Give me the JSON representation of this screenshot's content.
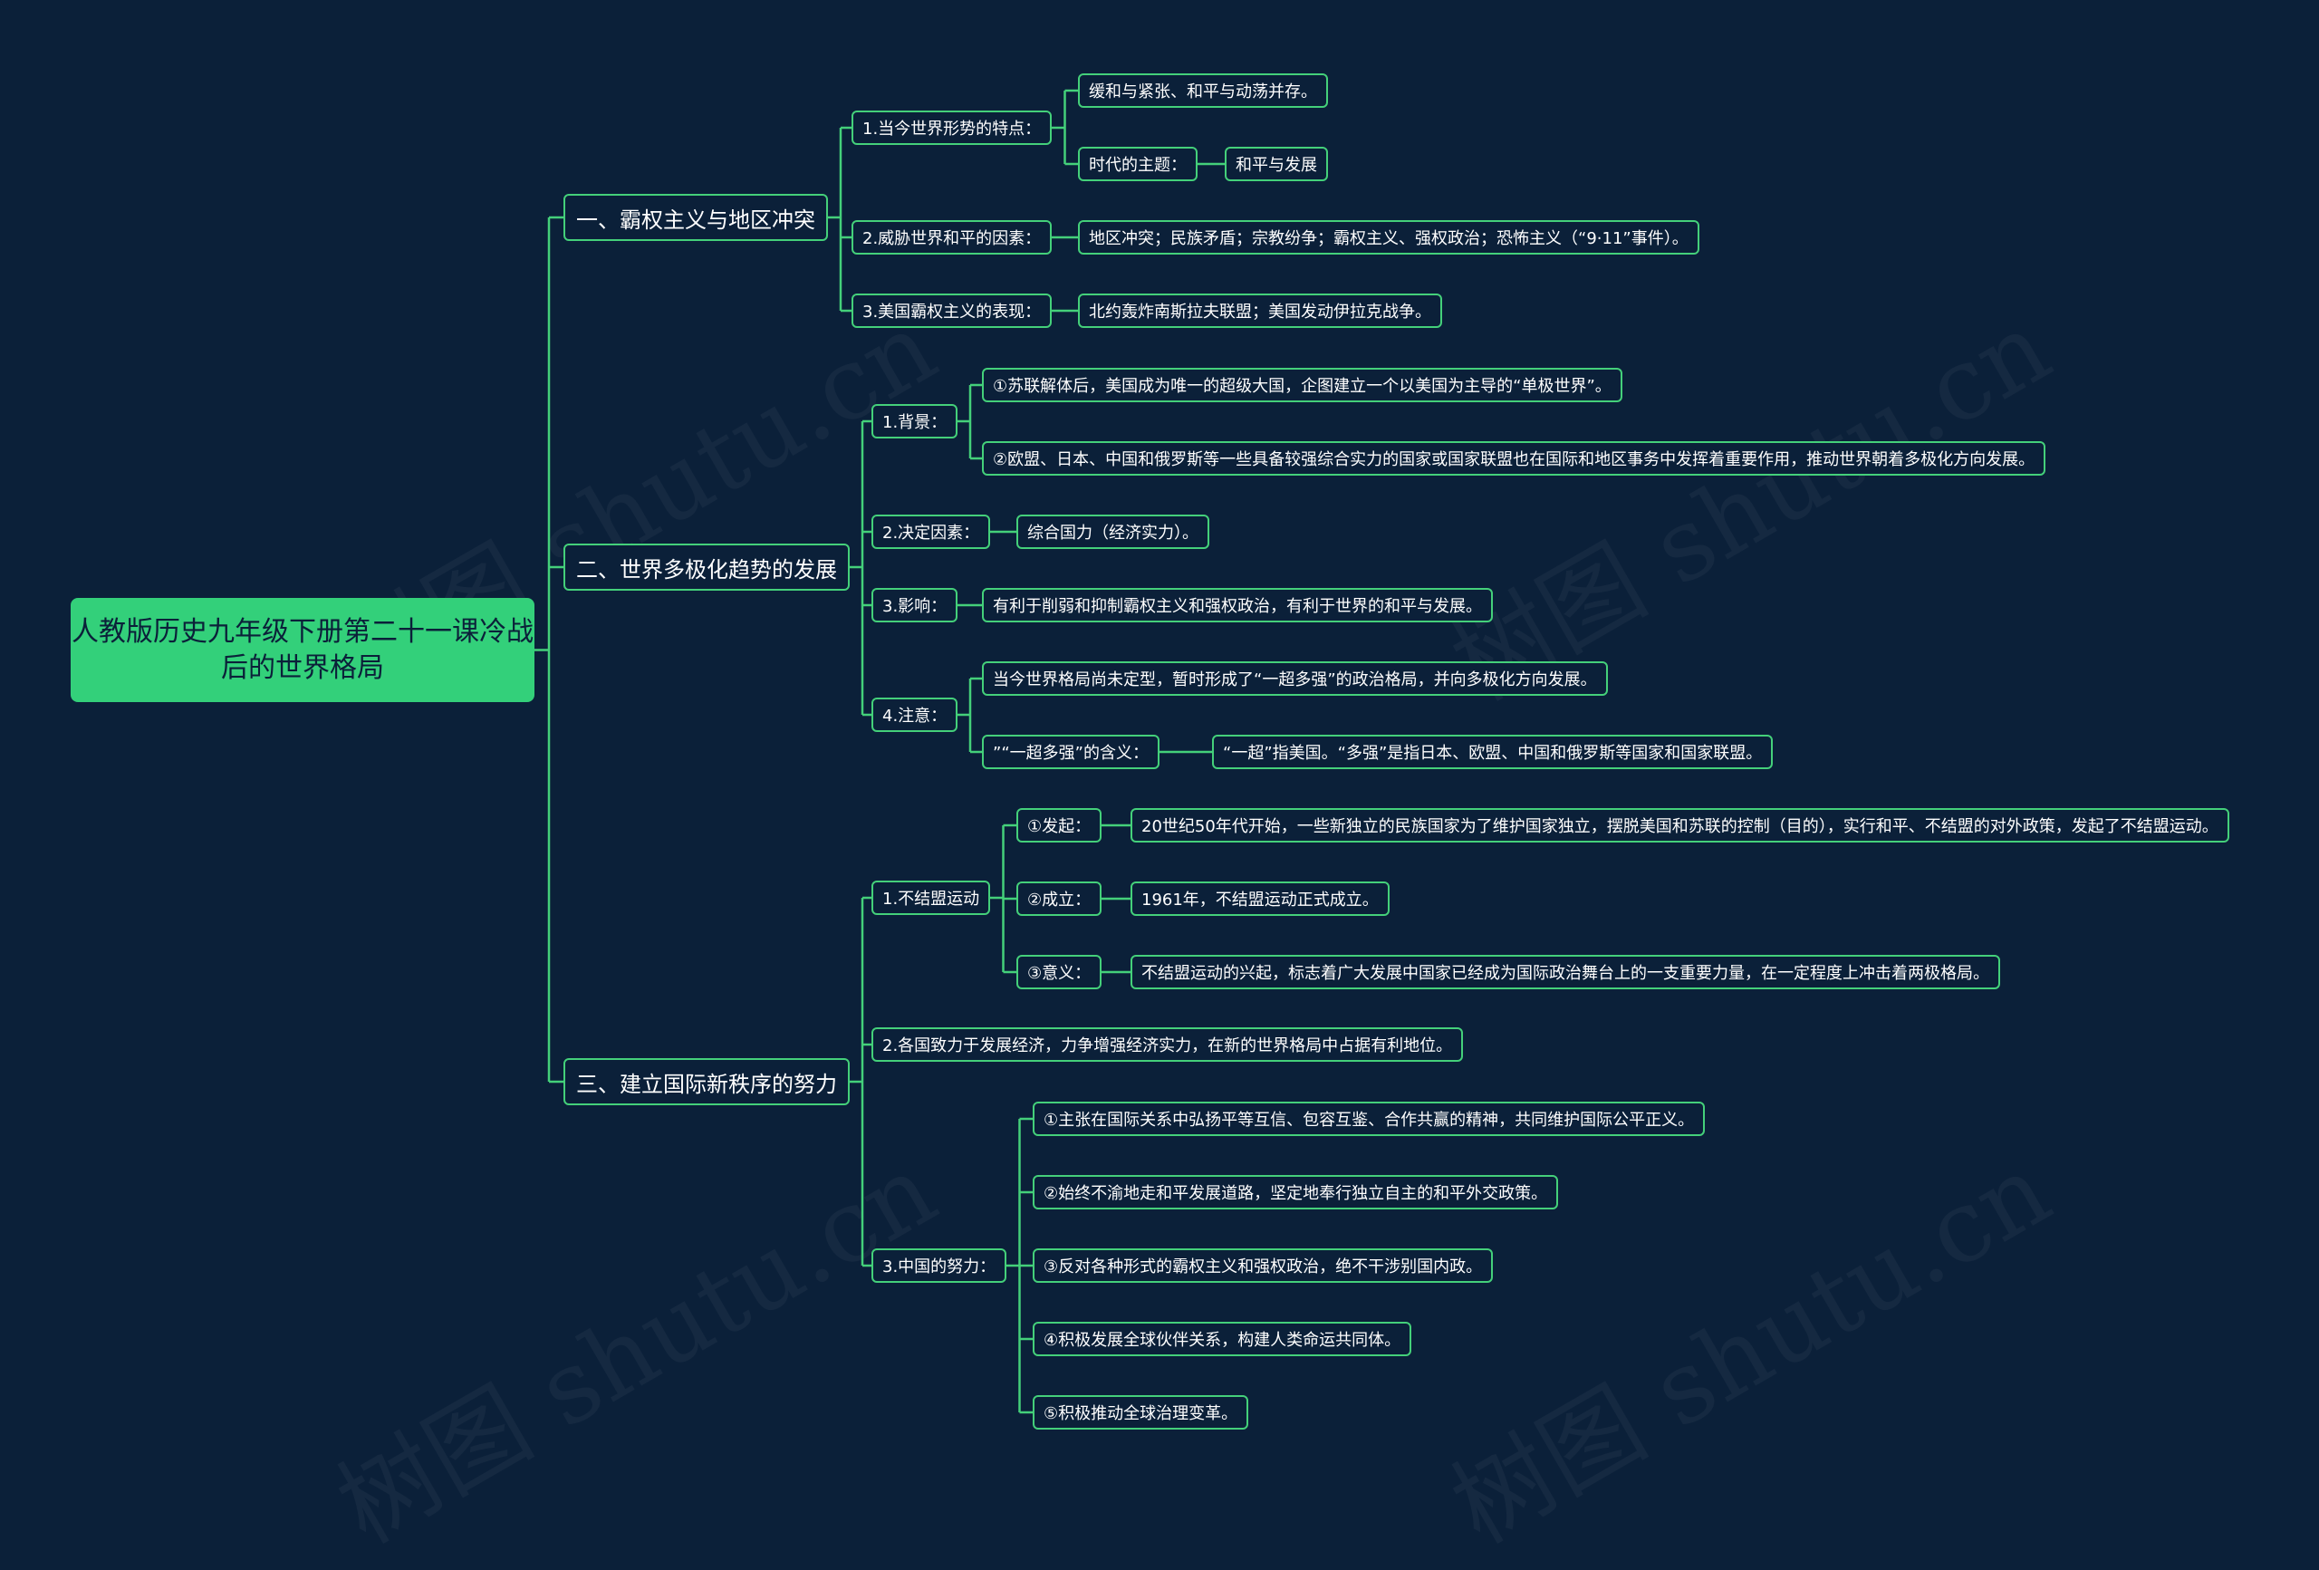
{
  "watermark": "树图 shutu.cn",
  "colors": {
    "background": "#0b2039",
    "accent": "#44d07a",
    "root_fill": "#33d07a",
    "text": "#ffffff"
  },
  "mindmap": {
    "root": "人教版历史九年级下册第二十一课冷战后的世界格局",
    "branches": [
      {
        "label": "一、霸权主义与地区冲突",
        "children": [
          {
            "label": "1.当今世界形势的特点：",
            "children": [
              {
                "label": "缓和与紧张、和平与动荡并存。"
              },
              {
                "label": "时代的主题：",
                "children": [
                  {
                    "label": "和平与发展"
                  }
                ]
              }
            ]
          },
          {
            "label": "2.威胁世界和平的因素：",
            "children": [
              {
                "label": "地区冲突；民族矛盾；宗教纷争；霸权主义、强权政治；恐怖主义（“9·11”事件）。"
              }
            ]
          },
          {
            "label": "3.美国霸权主义的表现：",
            "children": [
              {
                "label": "北约轰炸南斯拉夫联盟；美国发动伊拉克战争。"
              }
            ]
          }
        ]
      },
      {
        "label": "二、世界多极化趋势的发展",
        "children": [
          {
            "label": "1.背景：",
            "children": [
              {
                "label": "①苏联解体后，美国成为唯一的超级大国，企图建立一个以美国为主导的“单极世界”。"
              },
              {
                "label": "②欧盟、日本、中国和俄罗斯等一些具备较强综合实力的国家或国家联盟也在国际和地区事务中发挥着重要作用，推动世界朝着多极化方向发展。"
              }
            ]
          },
          {
            "label": "2.决定因素：",
            "children": [
              {
                "label": "综合国力（经济实力）。"
              }
            ]
          },
          {
            "label": "3.影响：",
            "children": [
              {
                "label": "有利于削弱和抑制霸权主义和强权政治，有利于世界的和平与发展。"
              }
            ]
          },
          {
            "label": "4.注意：",
            "children": [
              {
                "label": "当今世界格局尚未定型，暂时形成了“一超多强”的政治格局，并向多极化方向发展。"
              },
              {
                "label": "”“一超多强”的含义：",
                "children": [
                  {
                    "label": "“一超”指美国。“多强”是指日本、欧盟、中国和俄罗斯等国家和国家联盟。"
                  }
                ]
              }
            ]
          }
        ]
      },
      {
        "label": "三、建立国际新秩序的努力",
        "children": [
          {
            "label": "1.不结盟运动",
            "children": [
              {
                "label": "①发起：",
                "children": [
                  {
                    "label": "20世纪50年代开始，一些新独立的民族国家为了维护国家独立，摆脱美国和苏联的控制（目的），实行和平、不结盟的对外政策，发起了不结盟运动。"
                  }
                ]
              },
              {
                "label": "②成立：",
                "children": [
                  {
                    "label": "1961年，不结盟运动正式成立。"
                  }
                ]
              },
              {
                "label": "③意义：",
                "children": [
                  {
                    "label": "不结盟运动的兴起，标志着广大发展中国家已经成为国际政治舞台上的一支重要力量，在一定程度上冲击着两极格局。"
                  }
                ]
              }
            ]
          },
          {
            "label": "2.各国致力于发展经济，力争增强经济实力，在新的世界格局中占据有利地位。"
          },
          {
            "label": "3.中国的努力：",
            "children": [
              {
                "label": "①主张在国际关系中弘扬平等互信、包容互鉴、合作共赢的精神，共同维护国际公平正义。"
              },
              {
                "label": "②始终不渝地走和平发展道路，坚定地奉行独立自主的和平外交政策。"
              },
              {
                "label": "③反对各种形式的霸权主义和强权政治，绝不干涉别国内政。"
              },
              {
                "label": "④积极发展全球伙伴关系，构建人类命运共同体。"
              },
              {
                "label": "⑤积极推动全球治理变革。"
              }
            ]
          }
        ]
      }
    ]
  }
}
